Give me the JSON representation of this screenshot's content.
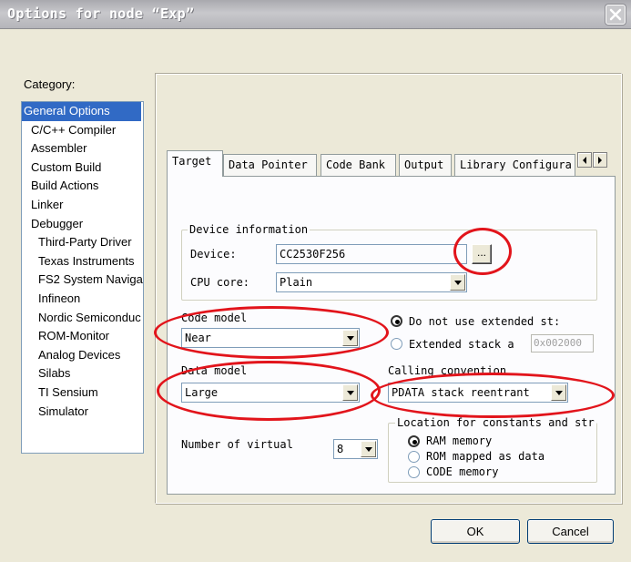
{
  "window": {
    "title": "Options for node “Exp”",
    "close_symbol": "✕"
  },
  "category": {
    "label": "Category:",
    "items": [
      {
        "label": "General Options",
        "level": 0,
        "selected": true
      },
      {
        "label": "C/C++ Compiler",
        "level": 1
      },
      {
        "label": "Assembler",
        "level": 1
      },
      {
        "label": "Custom Build",
        "level": 1
      },
      {
        "label": "Build Actions",
        "level": 1
      },
      {
        "label": "Linker",
        "level": 1
      },
      {
        "label": "Debugger",
        "level": 1
      },
      {
        "label": "Third-Party Driver",
        "level": 2
      },
      {
        "label": "Texas Instruments",
        "level": 2
      },
      {
        "label": "FS2 System Naviga",
        "level": 2
      },
      {
        "label": "Infineon",
        "level": 2
      },
      {
        "label": "Nordic Semiconduc",
        "level": 2
      },
      {
        "label": "ROM-Monitor",
        "level": 2
      },
      {
        "label": "Analog Devices",
        "level": 2
      },
      {
        "label": "Silabs",
        "level": 2
      },
      {
        "label": "TI Sensium",
        "level": 2
      },
      {
        "label": "Simulator",
        "level": 2
      }
    ]
  },
  "tabs": {
    "target": "Target",
    "data_pointer": "Data Pointer",
    "code_bank": "Code Bank",
    "output": "Output",
    "library_config": "Library Configura"
  },
  "device_info": {
    "group_title": "Device information",
    "device_label": "Device:",
    "device_value": "CC2530F256",
    "browse_label": "...",
    "cpu_core_label": "CPU core:",
    "cpu_core_value": "Plain"
  },
  "code_model": {
    "label": "Code model",
    "value": "Near"
  },
  "data_model": {
    "label": "Data model",
    "value": "Large"
  },
  "stack": {
    "no_extended": "Do not use extended st:",
    "extended": "Extended stack a",
    "extended_addr": "0x002000",
    "selected": "no_extended"
  },
  "calling_convention": {
    "label": "Calling convention",
    "value": "PDATA stack reentrant"
  },
  "virtual_registers": {
    "label": "Number of virtual",
    "value": "8"
  },
  "constants_location": {
    "group_title": "Location for constants and str",
    "ram": "RAM memory",
    "rom": "ROM mapped as data",
    "code": "CODE memory",
    "selected": "ram"
  },
  "buttons": {
    "ok": "OK",
    "cancel": "Cancel"
  },
  "colors": {
    "annotation": "#e2141b",
    "selection": "#316ac5",
    "dialog_bg": "#ece9d8"
  }
}
